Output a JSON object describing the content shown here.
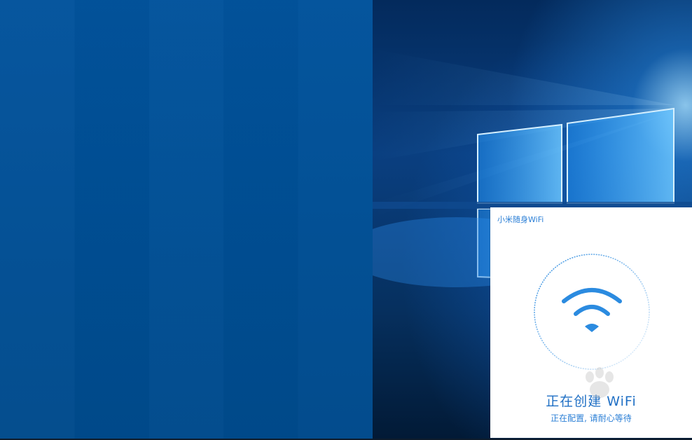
{
  "wifi_window": {
    "title": "小米随身WiFi",
    "status_main": "正在创建 WiFi",
    "status_sub": "正在配置, 请耐心等待"
  },
  "icons": {
    "wifi": "wifi-icon",
    "progress_ring": "loading-ring-icon"
  },
  "colors": {
    "accent": "#2b8be0",
    "left_panel": "#004f95",
    "window_bg": "#ffffff"
  }
}
